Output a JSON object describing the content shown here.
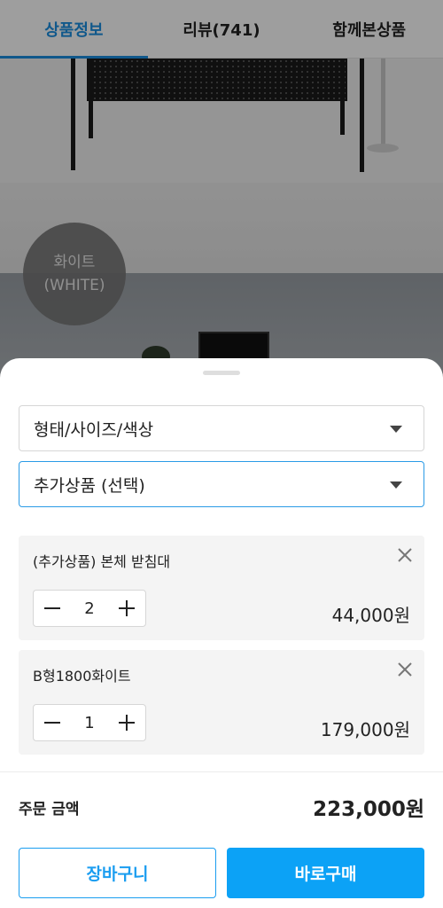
{
  "tabs": [
    {
      "label": "상품정보",
      "active": true
    },
    {
      "label": "리뷰(741)",
      "active": false
    },
    {
      "label": "함께본상품",
      "active": false
    }
  ],
  "color_badge": {
    "line1": "화이트",
    "line2": "(WHITE)"
  },
  "options": {
    "type_select": {
      "label": "형태/사이즈/색상"
    },
    "addon_select": {
      "label": "추가상품 (선택)"
    }
  },
  "cart_items": [
    {
      "name": "(추가상품) 본체 받침대",
      "quantity": "2",
      "price": "44,000원"
    },
    {
      "name": "B형1800화이트",
      "quantity": "1",
      "price": "179,000원"
    }
  ],
  "summary": {
    "label": "주문 금액",
    "total": "223,000원"
  },
  "buttons": {
    "cart": "장바구니",
    "buy": "바로구매"
  },
  "colors": {
    "accent": "#0ca2f6",
    "tab_active": "#1a8ee0"
  }
}
